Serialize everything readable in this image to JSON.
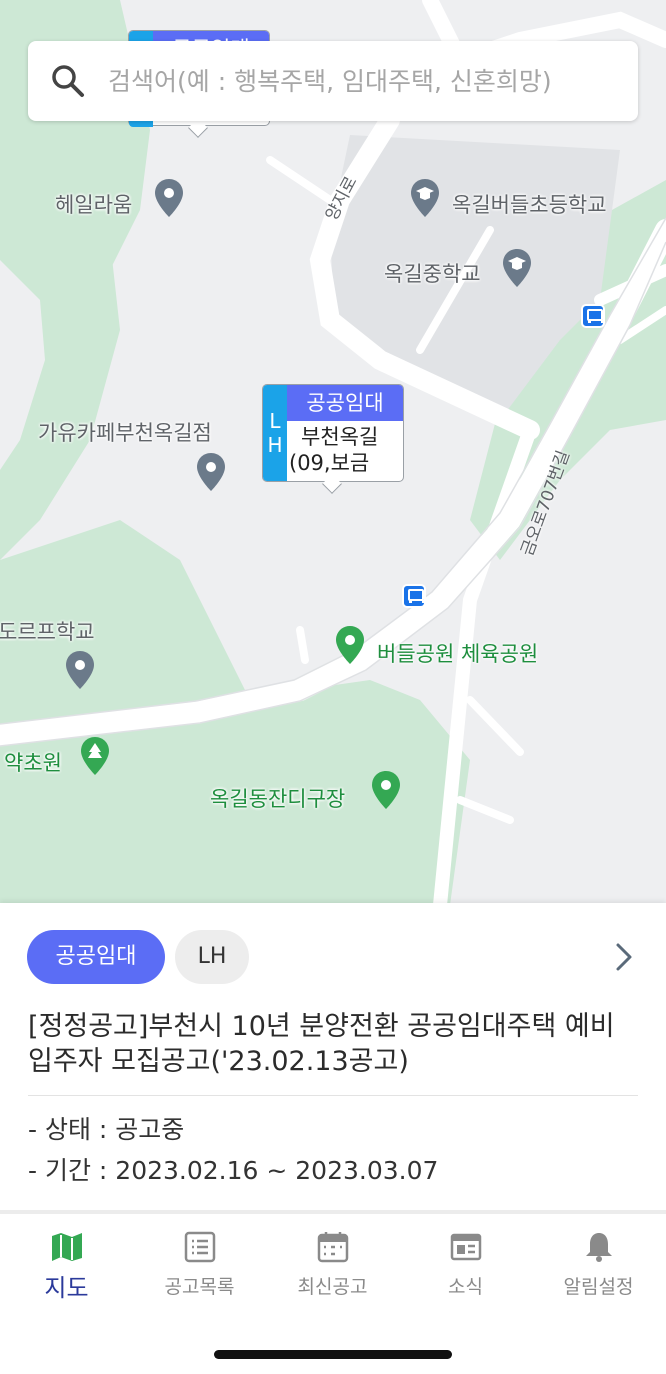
{
  "search": {
    "placeholder": "검색어(예 : 행복주택, 임대주택, 신혼희망)",
    "icon": "search-icon"
  },
  "map": {
    "places": {
      "haeil": "헤일라움",
      "school_elementary": "옥길버들초등학교",
      "school_middle": "옥길중학교",
      "cafe": "가유카페부천옥길점",
      "waldorf": "도르프학교",
      "park_sports": "버들공원 체육공원",
      "yakcho": "약초원",
      "jandi": "옥길동잔디구장"
    },
    "roads": {
      "yangji": "양지로",
      "geumo": "금오로707번길"
    },
    "marker": {
      "category": "공공임대",
      "org": "LH",
      "title": "부천옥길",
      "subtitle": "(09,보금"
    },
    "marker_top": {
      "category": "공공임대"
    }
  },
  "card": {
    "category": "공공임대",
    "org": "LH",
    "title": "[정정공고]부천시 10년 분양전환 공공임대주택 예비입주자 모집공고('23.02.13공고)",
    "status": "- 상태 : 공고중",
    "period": "- 기간 : 2023.02.16 ~ 2023.03.07"
  },
  "tabs": [
    {
      "label": "지도",
      "icon": "map-icon",
      "active": true
    },
    {
      "label": "공고목록",
      "icon": "list-icon",
      "active": false
    },
    {
      "label": "최신공고",
      "icon": "calendar-icon",
      "active": false
    },
    {
      "label": "소식",
      "icon": "news-icon",
      "active": false
    },
    {
      "label": "알림설정",
      "icon": "bell-icon",
      "active": false
    }
  ],
  "colors": {
    "accent": "#5b6df5",
    "lh_blue": "#1ba3e8",
    "active_tab": "#2b3a9b",
    "park": "#cde8d5",
    "road": "#ffffff"
  }
}
